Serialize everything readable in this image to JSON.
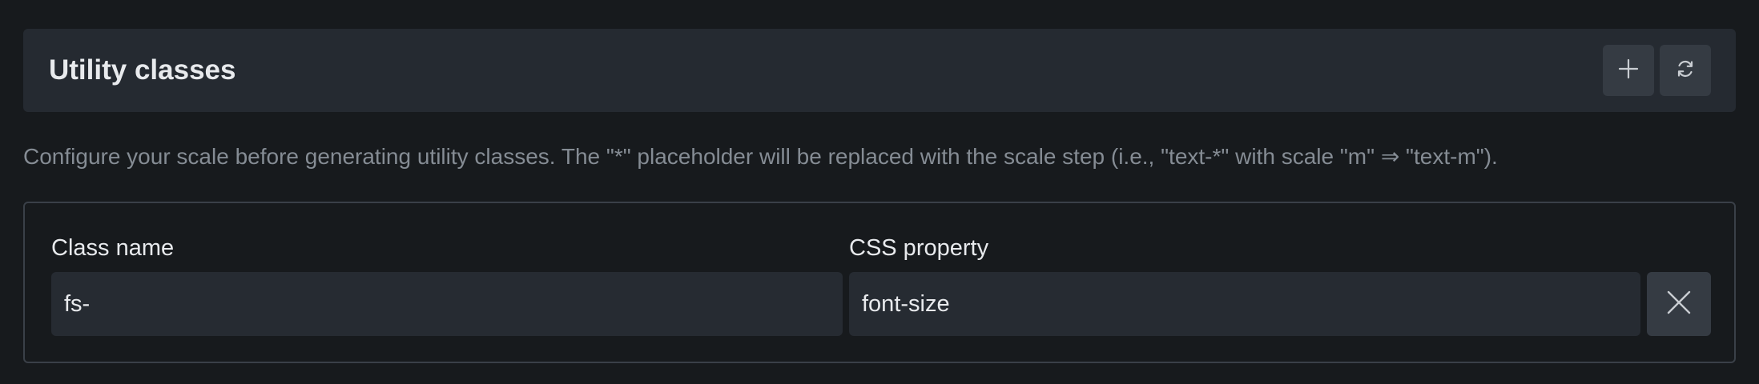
{
  "header": {
    "title": "Utility classes",
    "add_icon": "plus-icon",
    "refresh_icon": "refresh-icon"
  },
  "description": "Configure your scale before generating utility classes. The \"*\" placeholder will be replaced with the scale step (i.e., \"text-*\" with scale \"m\" ⇒ \"text-m\").",
  "row": {
    "class_name_label": "Class name",
    "class_name_value": "fs-",
    "css_property_label": "CSS property",
    "css_property_value": "font-size",
    "remove_icon": "close-icon"
  }
}
